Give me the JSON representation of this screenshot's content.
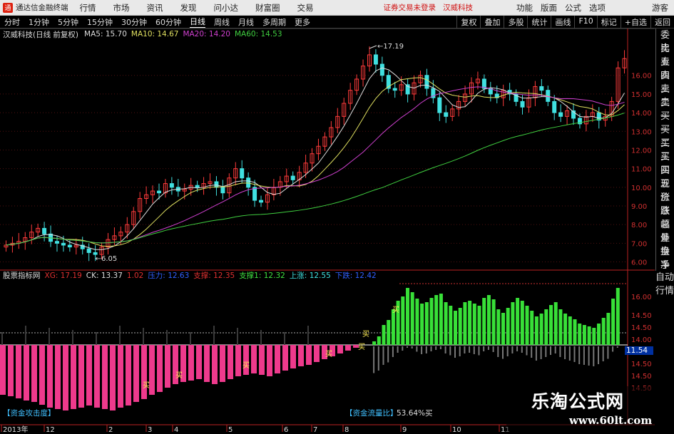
{
  "menubar": {
    "app_name": "通达信金融终端",
    "items": [
      "行情",
      "市场",
      "资讯",
      "发现",
      "问小达",
      "财富圈",
      "交易"
    ],
    "alert_text": "证券交易未登录",
    "stock_name": "汉威科技",
    "right_items": [
      "功能",
      "版面",
      "公式",
      "选项"
    ],
    "guest": "游客"
  },
  "toolbar": {
    "periods": [
      "分时",
      "1分钟",
      "5分钟",
      "15分钟",
      "30分钟",
      "60分钟",
      "日线",
      "周线",
      "月线",
      "多周期",
      "更多"
    ],
    "active_period": "日线",
    "right_buttons": [
      "复权",
      "叠加",
      "多股",
      "统计",
      "画线",
      "F10",
      "标记",
      "+自选",
      "返回"
    ]
  },
  "main_header": {
    "stock_title": "汉威科技(日线 前复权)",
    "ma5": "MA5: 15.70",
    "ma10": "MA10: 14.67",
    "ma20": "MA20: 14.20",
    "ma60": "MA60: 14.53"
  },
  "indicator_header": {
    "name": "股票指标网",
    "items": [
      {
        "text": "XG: 17.19",
        "color": "#e03030"
      },
      {
        "text": "CK: 13.37",
        "color": "#dddddd"
      },
      {
        "text": "1.02",
        "color": "#e03030"
      },
      {
        "text": "压力: 12.63",
        "color": "#3060ff"
      },
      {
        "text": "支撑: 12.35",
        "color": "#e03030"
      },
      {
        "text": "支撑1: 12.32",
        "color": "#40e040"
      },
      {
        "text": "上涨: 12.55",
        "color": "#40e0e0"
      },
      {
        "text": "下跌: 12.42",
        "color": "#3060ff"
      }
    ]
  },
  "side_panel": [
    "委比",
    "卖五",
    "卖四",
    "卖三",
    "卖二",
    "卖一",
    "买一",
    "买二",
    "买三",
    "买四",
    "买五",
    "现价",
    "涨跌",
    "涨幅",
    "总量",
    "外盘",
    "换手",
    "净资",
    "收益"
  ],
  "side_panel2": [
    "自动",
    "行情"
  ],
  "bottom": {
    "left_label": "【资金攻击度】",
    "center_label": "【资金流量比】",
    "center_value": "53.64%买",
    "price_box": "11.54"
  },
  "chart_data": {
    "type": "candlestick",
    "ylim": [
      5.6,
      17.9
    ],
    "y_ticks": [
      "16.00",
      "15.00",
      "14.00",
      "13.00",
      "12.00",
      "11.00",
      "10.00",
      "9.00",
      "8.00",
      "7.00",
      "6.00"
    ],
    "high_label": "17.19",
    "low_label": "6.05",
    "closes": [
      6.9,
      7.0,
      7.1,
      7.3,
      7.6,
      7.8,
      7.5,
      7.1,
      7.0,
      6.9,
      6.8,
      6.9,
      6.7,
      6.5,
      6.4,
      6.8,
      7.2,
      7.4,
      7.6,
      8.0,
      8.7,
      9.4,
      9.6,
      9.8,
      9.7,
      10.2,
      10.0,
      9.8,
      9.9,
      10.1,
      10.0,
      10.2,
      10.3,
      10.0,
      9.7,
      10.5,
      11.0,
      10.5,
      10.0,
      9.3,
      9.2,
      9.6,
      10.0,
      10.3,
      10.6,
      10.4,
      10.8,
      11.3,
      11.8,
      12.2,
      12.7,
      13.2,
      13.8,
      14.5,
      15.2,
      15.8,
      16.5,
      17.1,
      16.6,
      16.0,
      15.3,
      15.2,
      15.5,
      15.0,
      15.6,
      16.0,
      15.3,
      14.8,
      14.0,
      13.8,
      14.2,
      14.6,
      15.0,
      15.6,
      15.8,
      15.3,
      15.0,
      14.8,
      15.2,
      15.0,
      14.6,
      14.3,
      14.8,
      15.4,
      15.2,
      14.6,
      14.0,
      13.8,
      14.1,
      13.7,
      13.4,
      13.8,
      14.0,
      13.6,
      13.8,
      14.6,
      16.4,
      16.9
    ],
    "ma_series": [
      {
        "name": "MA5",
        "color": "#dddddd"
      },
      {
        "name": "MA10",
        "color": "#e0e060"
      },
      {
        "name": "MA20",
        "color": "#d040d0"
      },
      {
        "name": "MA60",
        "color": "#40d040"
      }
    ],
    "x_ticks": [
      "2013年",
      "12",
      "2",
      "3",
      "4",
      "5",
      "6",
      "7",
      "8",
      "9",
      "10",
      "11"
    ],
    "indicator_right_ticks": [
      "16.00",
      "14.50",
      "14.50",
      "14.00",
      "14.50",
      "14.50",
      "14.50",
      "14.50"
    ],
    "buy_markers": [
      "买",
      "买",
      "买",
      "买",
      "买",
      "买",
      "买"
    ],
    "green_bars": [
      0,
      0,
      0,
      5,
      12,
      28,
      35,
      50,
      62,
      68,
      80,
      74,
      65,
      58,
      60,
      66,
      70,
      72,
      60,
      55,
      48,
      52,
      60,
      62,
      58,
      55,
      66,
      70,
      64,
      50,
      45,
      52,
      60,
      66,
      62,
      55,
      48,
      40,
      44,
      50,
      56,
      60,
      50,
      44,
      40,
      36,
      30,
      28,
      26,
      24,
      30,
      38,
      45,
      65,
      80
    ],
    "pink_bars": [
      70,
      72,
      75,
      78,
      80,
      84,
      88,
      90,
      92,
      90,
      88,
      85,
      88,
      90,
      92,
      88,
      85,
      80,
      76,
      70,
      66,
      60,
      55,
      52,
      50,
      48,
      52,
      55,
      52,
      48,
      44,
      42,
      40,
      42,
      44,
      40,
      36,
      33,
      30,
      28,
      24,
      20,
      16,
      12,
      8,
      4
    ]
  }
}
